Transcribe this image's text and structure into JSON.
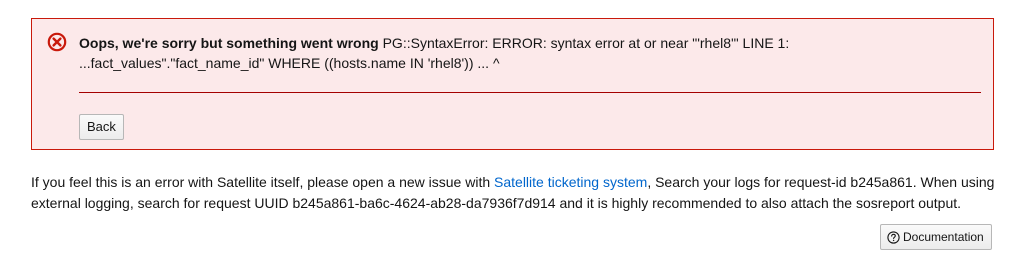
{
  "alert": {
    "icon": "error-circle-icon",
    "title": "Oops, we're sorry but something went wrong",
    "message": " PG::SyntaxError: ERROR: syntax error at or near \"'rhel8'\" LINE 1: ...fact_values\".\"fact_name_id\" WHERE ((hosts.name IN 'rhel8')) ... ^",
    "back_label": "Back",
    "color": "#c9190b",
    "background": "#fce9ea"
  },
  "info": {
    "text_before_link": "If you feel this is an error with Satellite itself, please open a new issue with ",
    "link_text": "Satellite ticketing system",
    "text_after_link": ", Search your logs for request-id b245a861. When using external logging, search for request UUID b245a861-ba6c-4624-ab28-da7936f7d914 and it is highly recommended to also attach the sosreport output.",
    "link_color": "#0066cc"
  },
  "documentation_button": {
    "icon": "help-circle-icon",
    "label": "Documentation"
  }
}
